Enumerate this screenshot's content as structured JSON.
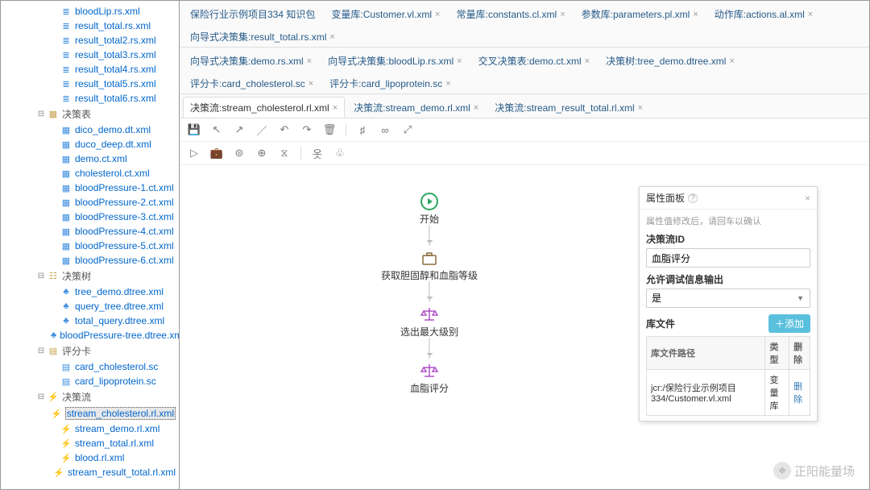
{
  "tree": {
    "rs": [
      "bloodLip.rs.xml",
      "result_total.rs.xml",
      "result_total2.rs.xml",
      "result_total3.rs.xml",
      "result_total4.rs.xml",
      "result_total5.rs.xml",
      "result_total6.rs.xml"
    ],
    "decisiontable": {
      "name": "决策表",
      "items": [
        "dico_demo.dt.xml",
        "duco_deep.dt.xml",
        "demo.ct.xml",
        "cholesterol.ct.xml",
        "bloodPressure-1.ct.xml",
        "bloodPressure-2.ct.xml",
        "bloodPressure-3.ct.xml",
        "bloodPressure-4.ct.xml",
        "bloodPressure-5.ct.xml",
        "bloodPressure-6.ct.xml"
      ]
    },
    "decisiontree": {
      "name": "决策树",
      "items": [
        "tree_demo.dtree.xml",
        "query_tree.dtree.xml",
        "total_query.dtree.xml",
        "bloodPressure-tree.dtree.xml"
      ]
    },
    "scorecard": {
      "name": "评分卡",
      "items": [
        "card_cholesterol.sc",
        "card_lipoprotein.sc"
      ]
    },
    "ruleflow": {
      "name": "决策流",
      "items": [
        "stream_cholesterol.rl.xml",
        "stream_demo.rl.xml",
        "stream_total.rl.xml",
        "blood.rl.xml",
        "stream_result_total.rl.xml"
      ]
    }
  },
  "tabs_row1": [
    "保险行业示例项目334 知识包",
    "变量库:Customer.vl.xml",
    "常量库:constants.cl.xml",
    "参数库:parameters.pl.xml",
    "动作库:actions.al.xml",
    "向导式决策集:result_total.rs.xml"
  ],
  "tabs_row2": [
    "向导式决策集:demo.rs.xml",
    "向导式决策集:bloodLip.rs.xml",
    "交叉决策表:demo.ct.xml",
    "决策树:tree_demo.dtree.xml",
    "评分卡:card_cholesterol.sc",
    "评分卡:card_lipoprotein.sc"
  ],
  "tabs_row3": [
    "决策流:stream_cholesterol.rl.xml",
    "决策流:stream_demo.rl.xml",
    "决策流:stream_result_total.rl.xml"
  ],
  "active_tab": 0,
  "flow": {
    "n0": "开始",
    "n1": "获取胆固醇和血脂等级",
    "n2": "选出最大级别",
    "n3": "血脂评分"
  },
  "panel": {
    "title": "属性面板",
    "hint": "属性值修改后，请回车以确认",
    "id_label": "决策流ID",
    "id_value": "血脂评分",
    "debug_label": "允许调试信息输出",
    "debug_value": "是",
    "lib_label": "库文件",
    "add_label": "＋添加",
    "th1": "库文件路径",
    "th2": "类型",
    "th3": "删除",
    "td1": "jcr:/保险行业示例项目334/Customer.vl.xml",
    "td2": "变量库",
    "td3": "删除"
  },
  "watermark": "正阳能量场"
}
